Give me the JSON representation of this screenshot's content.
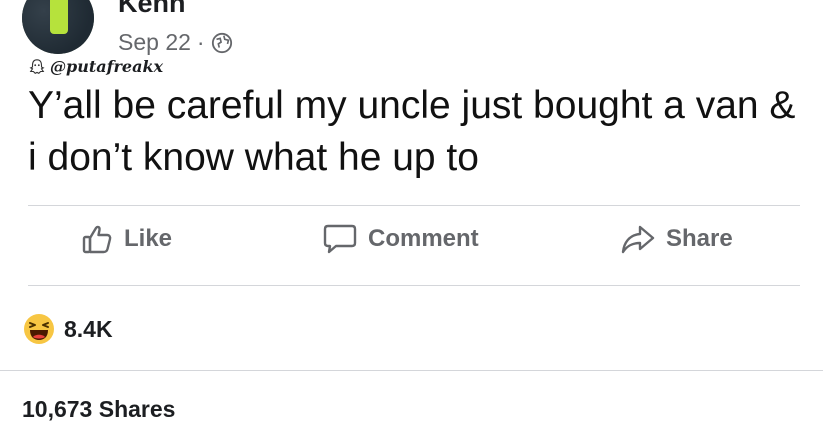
{
  "post": {
    "author_name": "Kenn",
    "date": "Sep 22",
    "separator": "·",
    "privacy_icon": "globe-icon",
    "watermark_handle": "@putafreakx",
    "watermark_icon": "snapchat-ghost-icon",
    "text": "Y’all be careful my uncle just bought a van & i don’t know what he up to"
  },
  "actions": {
    "like_label": "Like",
    "like_icon": "thumbs-up-icon",
    "comment_label": "Comment",
    "comment_icon": "comment-bubble-icon",
    "share_label": "Share",
    "share_icon": "share-arrow-icon"
  },
  "stats": {
    "reaction_icon": "haha-emoji-icon",
    "reaction_count": "8.4K",
    "shares": "10,673 Shares"
  },
  "colors": {
    "text": "#1c1e21",
    "secondary": "#65676b",
    "divider": "#d4d6da",
    "haha_yellow": "#f7c643"
  }
}
